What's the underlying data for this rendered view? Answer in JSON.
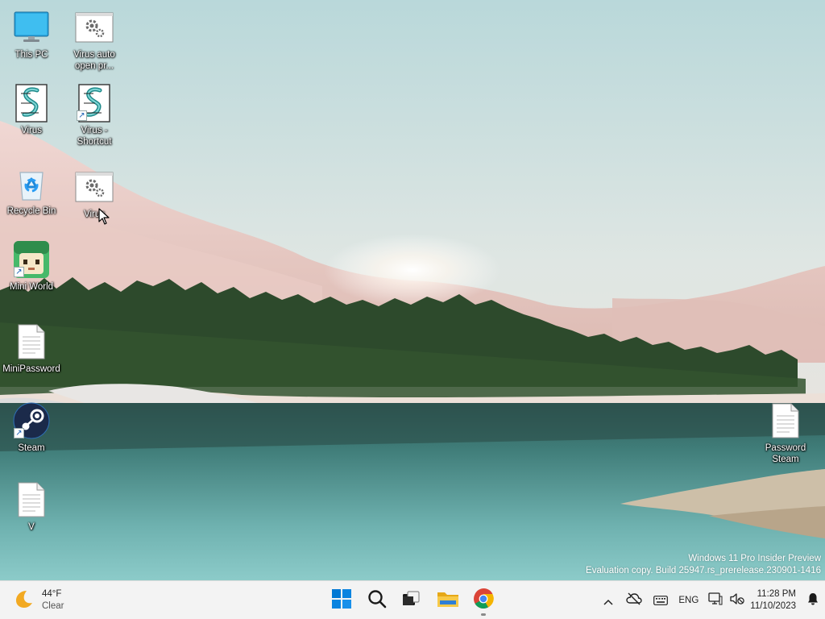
{
  "desktop": {
    "icons": [
      {
        "id": "this-pc",
        "label": "This PC",
        "icon": "monitor-icon"
      },
      {
        "id": "virus-auto",
        "label": "Virus auto open pr...",
        "icon": "settings-file-icon"
      },
      {
        "id": "virus-script",
        "label": "Virus",
        "icon": "script-file-icon"
      },
      {
        "id": "virus-shortcut",
        "label": "Virus - Shortcut",
        "icon": "script-file-icon"
      },
      {
        "id": "recycle-bin",
        "label": "Recycle Bin",
        "icon": "recycle-bin-icon"
      },
      {
        "id": "virus-settings",
        "label": "Virus",
        "icon": "settings-file-icon"
      },
      {
        "id": "mini-world",
        "label": "Mini World",
        "icon": "mini-world-app-icon"
      },
      {
        "id": "minipassword",
        "label": "MiniPassword",
        "icon": "text-file-icon"
      },
      {
        "id": "steam",
        "label": "Steam",
        "icon": "steam-icon"
      },
      {
        "id": "v",
        "label": "V",
        "icon": "text-file-icon"
      },
      {
        "id": "password-steam",
        "label": "Password Steam",
        "icon": "text-file-icon"
      }
    ]
  },
  "watermark": {
    "line1": "Windows 11 Pro Insider Preview",
    "line2": "Evaluation copy. Build 25947.rs_prerelease.230901-1416"
  },
  "taskbar": {
    "weather": {
      "temp": "44°F",
      "condition": "Clear",
      "icon": "moon-icon"
    },
    "apps": [
      {
        "name": "start",
        "icon": "windows-logo-icon"
      },
      {
        "name": "search",
        "icon": "search-icon"
      },
      {
        "name": "task-view",
        "icon": "task-view-icon"
      },
      {
        "name": "file-explorer",
        "icon": "folder-icon"
      },
      {
        "name": "chrome",
        "icon": "chrome-icon",
        "active": true
      }
    ],
    "tray": {
      "language": "ENG",
      "time": "11:28 PM",
      "date": "11/10/2023"
    }
  },
  "colors": {
    "taskbar_bg": "#f3f3f3",
    "windows_blue": "#0078d4",
    "folder_yellow": "#f4c430"
  }
}
